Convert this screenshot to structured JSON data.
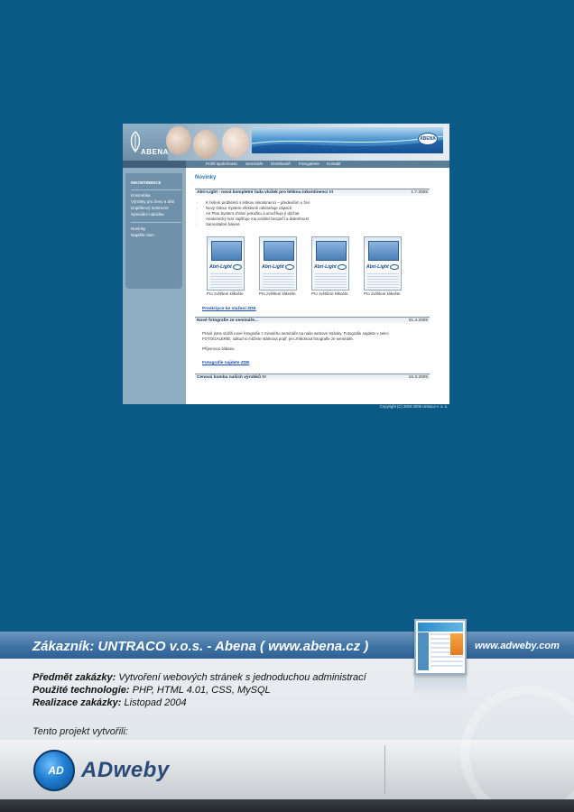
{
  "site": {
    "logo": "ABENA",
    "banner_badge": "ABENA",
    "nav": [
      "Profil společnosti",
      "Semináře",
      "Distributoři",
      "Fotogalerie",
      "Kontakt"
    ],
    "sidebar": {
      "title": "INKONTINENCE",
      "items": [
        "Kosmetika",
        "Výrobky pro ženy a děti",
        "Doplňkový sortiment",
        "Speciální nabídka"
      ],
      "items2": [
        "Novinky",
        "Napište nám"
      ]
    },
    "content_title": "Novinky",
    "news": [
      {
        "title": "Abri-Light - nová kompletní řada vložek pro lehkou inkontinenci !!!",
        "date": "1.7.2005",
        "bullets": [
          "K řešení problémů s lehkou inkontinencí – především u žen",
          "Nový Odour System efektivně odstraňuje zápach",
          "Air Plus System chrání pokožku a umožňuje jí dýchat",
          "Anatomický tvar zajišťuje ma ximální bezpečí a diskrétnost",
          "Samostatně balené"
        ],
        "products": [
          {
            "brand": "Abri-Light",
            "caption": "Pro zvětšení klikněte"
          },
          {
            "brand": "Abri-Light",
            "caption": "Pro zvětšení klikněte"
          },
          {
            "brand": "Abri-Light",
            "caption": "Pro zvětšení klikněte"
          },
          {
            "brand": "Abri-Light",
            "caption": "Pro zvětšení klikněte"
          }
        ],
        "link": "Preskripce ke stažení ZDE"
      },
      {
        "title": "Nové fotografie ze semináře...",
        "date": "31.4.2005",
        "paragraphs": [
          "Právě jsme vložili nové fotografie z minulého semináře na naše webové stránky. Fotografie najdete v sekci",
          "FOTOGALERIE, odkud si můžete stáhnout popř. jen zhlédnout fotografie ze semináře.",
          "Příjemnou zábavu."
        ],
        "link": "Fotografie najdete ZDE"
      },
      {
        "title": "Cenová bomba našich výrobků !!!",
        "date": "16.3.2005"
      }
    ],
    "copyright": "Copyright (C) 2004-2005 Untraco v. o. s."
  },
  "panel": {
    "customer": "Zákazník: UNTRACO v.o.s. - Abena ( www.abena.cz )",
    "url": "www.adweby.com",
    "subject_label": "Předmět zakázky:",
    "subject_value": "Vytvoření webových stránek s jednoduchou administrací",
    "tech_label": "Použité technologie:",
    "tech_value": "PHP, HTML 4.01, CSS, MySQL",
    "date_label": "Realizace zakázky:",
    "date_value": "Listopad 2004",
    "created_by": "Tento projekt vytvořili:",
    "brand_logo_text": "AD",
    "brand_name": "ADweby"
  }
}
